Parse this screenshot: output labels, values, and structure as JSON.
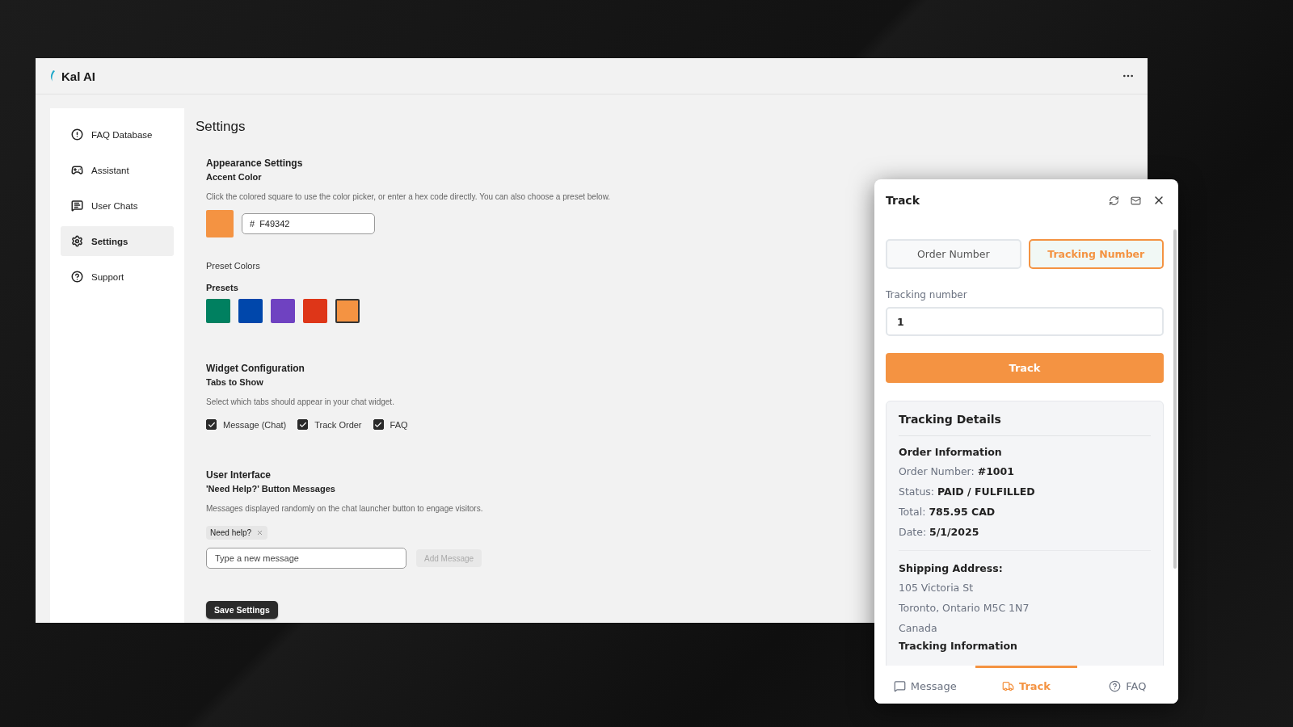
{
  "app": {
    "title": "Kal AI"
  },
  "sidebar": {
    "items": [
      {
        "label": "FAQ Database",
        "selected": false
      },
      {
        "label": "Assistant",
        "selected": false
      },
      {
        "label": "User Chats",
        "selected": false
      },
      {
        "label": "Settings",
        "selected": true
      },
      {
        "label": "Support",
        "selected": false
      }
    ]
  },
  "settings": {
    "title": "Settings",
    "appearance": {
      "title": "Appearance Settings",
      "subtitle": "Accent Color",
      "description": "Click the colored square to use the color picker, or enter a hex code directly. You can also choose a preset below.",
      "hex_prefix": "#",
      "hex_value": "F49342",
      "preset_colors_label": "Preset Colors",
      "presets_title": "Presets",
      "presets": [
        {
          "color": "#008060",
          "selected": false
        },
        {
          "color": "#0047ab",
          "selected": false
        },
        {
          "color": "#6f42c1",
          "selected": false
        },
        {
          "color": "#de3618",
          "selected": false
        },
        {
          "color": "#f49342",
          "selected": true
        }
      ]
    },
    "widget_configuration": {
      "title": "Widget Configuration",
      "subtitle": "Tabs to Show",
      "description": "Select which tabs should appear in your chat widget.",
      "tabs": [
        {
          "label": "Message (Chat)",
          "checked": true
        },
        {
          "label": "Track Order",
          "checked": true
        },
        {
          "label": "FAQ",
          "checked": true
        }
      ]
    },
    "user_interface": {
      "title": "User Interface",
      "subtitle": "'Need Help?' Button Messages",
      "description": "Messages displayed randomly on the chat launcher button to engage visitors.",
      "messages": [
        {
          "text": "Need help?"
        }
      ],
      "new_message": {
        "placeholder": "Type a new message"
      },
      "add_button": {
        "label": "Add Message",
        "disabled": true
      }
    },
    "save_button": "Save Settings"
  },
  "widget": {
    "title": "Track",
    "mode_tabs": [
      {
        "label": "Order Number",
        "selected": false
      },
      {
        "label": "Tracking Number",
        "selected": true
      }
    ],
    "field": {
      "label": "Tracking number",
      "value": "1"
    },
    "track_button": "Track",
    "details": {
      "title": "Tracking Details",
      "order_heading": "Order Information",
      "order_fields": [
        {
          "label": "Order Number:",
          "value": "#1001"
        },
        {
          "label": "Status:",
          "value": "PAID / FULFILLED"
        },
        {
          "label": "Total:",
          "value": "785.95 CAD"
        },
        {
          "label": "Date:",
          "value": "5/1/2025"
        }
      ],
      "shipping_heading": "Shipping Address:",
      "address_lines": [
        "105 Victoria St",
        "Toronto, Ontario M5C 1N7",
        "Canada"
      ],
      "tracking_heading": "Tracking Information"
    },
    "nav": [
      {
        "label": "Message",
        "selected": false
      },
      {
        "label": "Track",
        "selected": true
      },
      {
        "label": "FAQ",
        "selected": false
      }
    ]
  }
}
